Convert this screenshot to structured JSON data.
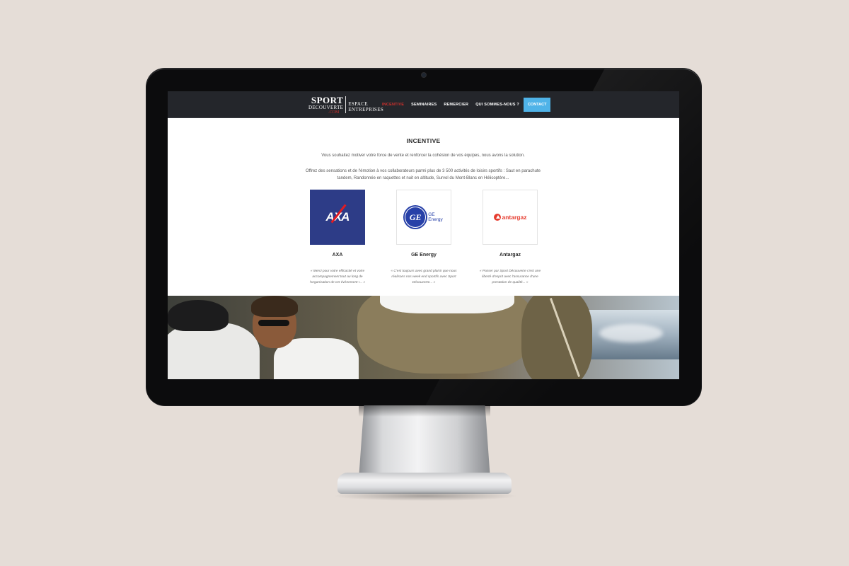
{
  "logo": {
    "sport": "SPORT",
    "decouverte": "DECOUVERTE",
    "com": ".COM",
    "espace": "ESPACE",
    "entreprises": "ENTREPRISES"
  },
  "nav": {
    "items": [
      "INCENTIVE",
      "SEMINAIRES",
      "REMERCIER",
      "QUI SOMMES-NOUS ?"
    ],
    "active": "INCENTIVE",
    "contact": "CONTACT"
  },
  "colors": {
    "header_bg": "#24262b",
    "active_nav": "#d0312d",
    "contact_button": "#4fb3e8",
    "axa_blue": "#2d3c87",
    "ge_blue": "#2740a8",
    "antargaz_red": "#e63b2e"
  },
  "content": {
    "title": "INCENTIVE",
    "intro_1": "Vous souhaitez motiver votre force de vente et renforcer la cohésion de vos équipes, nous avons la solution.",
    "intro_2": "Offrez des sensations et de l'émotion à vos collaborateurs parmi plus de 3 500 activités de loisirs sportifs : Saut en parachute tandem, Randonnée en raquettes et nuit en altitude, Survol du Mont-Blanc en Hélicoptère..."
  },
  "clients": [
    {
      "name": "AXA",
      "logo_text": "AXA",
      "quote": "« Merci pour votre efficacité et votre accompagnement tout au long de l'organisation de cet évènement !... »"
    },
    {
      "name": "GE Energy",
      "logo_text": "GE",
      "logo_sub_1": "GE",
      "logo_sub_2": "Energy",
      "quote": "« C'est toujours avec grand plaisir que nous réalisons nos week end sportifs avec Sport Découverte... »"
    },
    {
      "name": "Antargaz",
      "logo_text": "antargaz",
      "quote": "« Passer par Sport Découverte c'est une liberté d'esprit avec l'assurance d'une prestation de qualité... »"
    }
  ],
  "icons": {
    "camera": "webcam-icon",
    "axa_logo": "axa-logo-icon",
    "ge_logo": "ge-energy-logo-icon",
    "antargaz_logo": "antargaz-logo-icon"
  }
}
